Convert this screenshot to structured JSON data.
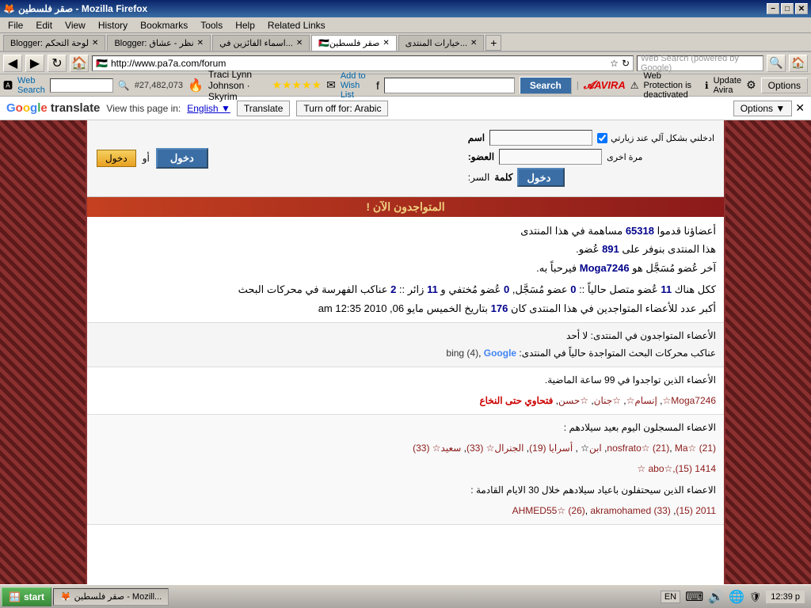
{
  "titlebar": {
    "title": "صقر فلسطين - Mozilla Firefox",
    "btn_minimize": "−",
    "btn_maximize": "□",
    "btn_close": "✕"
  },
  "menu": {
    "items": [
      "File",
      "Edit",
      "View",
      "History",
      "Bookmarks",
      "Tools",
      "Help",
      "Related Links"
    ]
  },
  "tabs": [
    {
      "label": "Blogger: لوحة التحكم الرئيسية",
      "active": false
    },
    {
      "label": "Blogger: نظر - عشاق الكوره",
      "active": false
    },
    {
      "label": "اسماء الفائزين في مسا...",
      "active": false
    },
    {
      "label": "صقر فلسطين",
      "active": true
    },
    {
      "label": "خيارات المنتدى - منتدى أ...",
      "active": false
    }
  ],
  "navbar": {
    "address": "http://www.pa7a.com/forum",
    "search_placeholder": "Web Search (powered by Google)"
  },
  "toolbar": {
    "web_search_label": "Web Search",
    "counter": "#27,482,073",
    "search_placeholder": "",
    "search_btn": "Search",
    "avira_label": "AVIRA",
    "protection_text": "Web Protection is deactivated",
    "update_text": "Update Avira",
    "options_label": "Options"
  },
  "translate_bar": {
    "google_translate": "Google translate",
    "view_text": "View this page in:",
    "lang": "English",
    "translate_btn": "Translate",
    "turnoff_btn": "Turn off for: Arabic",
    "options_btn": "Options"
  },
  "forum": {
    "login": {
      "name_label": "اسم",
      "member_label": "العضو:",
      "password_label": "كلمة",
      "secret_label": "السر:",
      "remember_label": "ادخلني بشكل آلي عند زيارتي",
      "again_label": "مرة اخرى",
      "login_btn": "دخول",
      "or_text": "أو",
      "register_btn": "دخول"
    },
    "online_header": "المتواجدون الآن !",
    "stats": {
      "line1": "أعضاؤنا قدموا 65318 مساهمة في هذا المنتدى",
      "line2": "هذا المنتدى بنوفر على 891 عُضو.",
      "line3_pre": "آخر عُضو مُسَجَّل هو",
      "line3_name": "Moga7246",
      "line3_post": "فيرحباً به.",
      "online_line": "ككل هناك 11 عُضو متصل حالياً :: 0 عضو مُسَجَّل, 0 عُضو مُختفي و 11 زائر :: 2 عناكب الفهرسة في محركات البحث",
      "record_line": "أكبر عدد للأعضاء المتواجدين في هذا المنتدى كان 176 بتاريخ الخميس مايو 06, 2010 am 12:35"
    },
    "online_members": {
      "header": "الأعضاء المتواجدون في المنتدى:",
      "value": "لا أحد",
      "bots_line": "عناكب محركات البحث المتواجدة حالياً في المنتدى: bing (4), Google"
    },
    "recent": {
      "header": "الأعضاء الذين تواجدوا في 99 ساعة الماضية.",
      "users": "Moga7246☆, إنسام☆, ☆جنان, ☆حسن, فتحاوي حتى النخاع"
    },
    "birthday": {
      "header": "الاعضاء المسجلون اليوم بعيد سيلادهم :",
      "users": "nosfrato☆ (21), Ma☆ (21), ابن أسرايا (19), الجنرال☆ (33), سعيد☆ (33), abo☆,(15) 1414 ☆",
      "line2": "الاعضاء الذين سيحتفلون باعياد سيلادهم خلال 30 الايام القادمة:",
      "line2_users": "2011 (15), AHMED55☆ (26), akramohamed (33)"
    }
  },
  "taskbar": {
    "start_label": "start",
    "items": [
      {
        "label": "صقر فلسطين - Mozill...",
        "icon": "🦊"
      },
      {
        "label": "",
        "icon": "B"
      }
    ],
    "lang": "EN",
    "time": "12:39 p"
  }
}
